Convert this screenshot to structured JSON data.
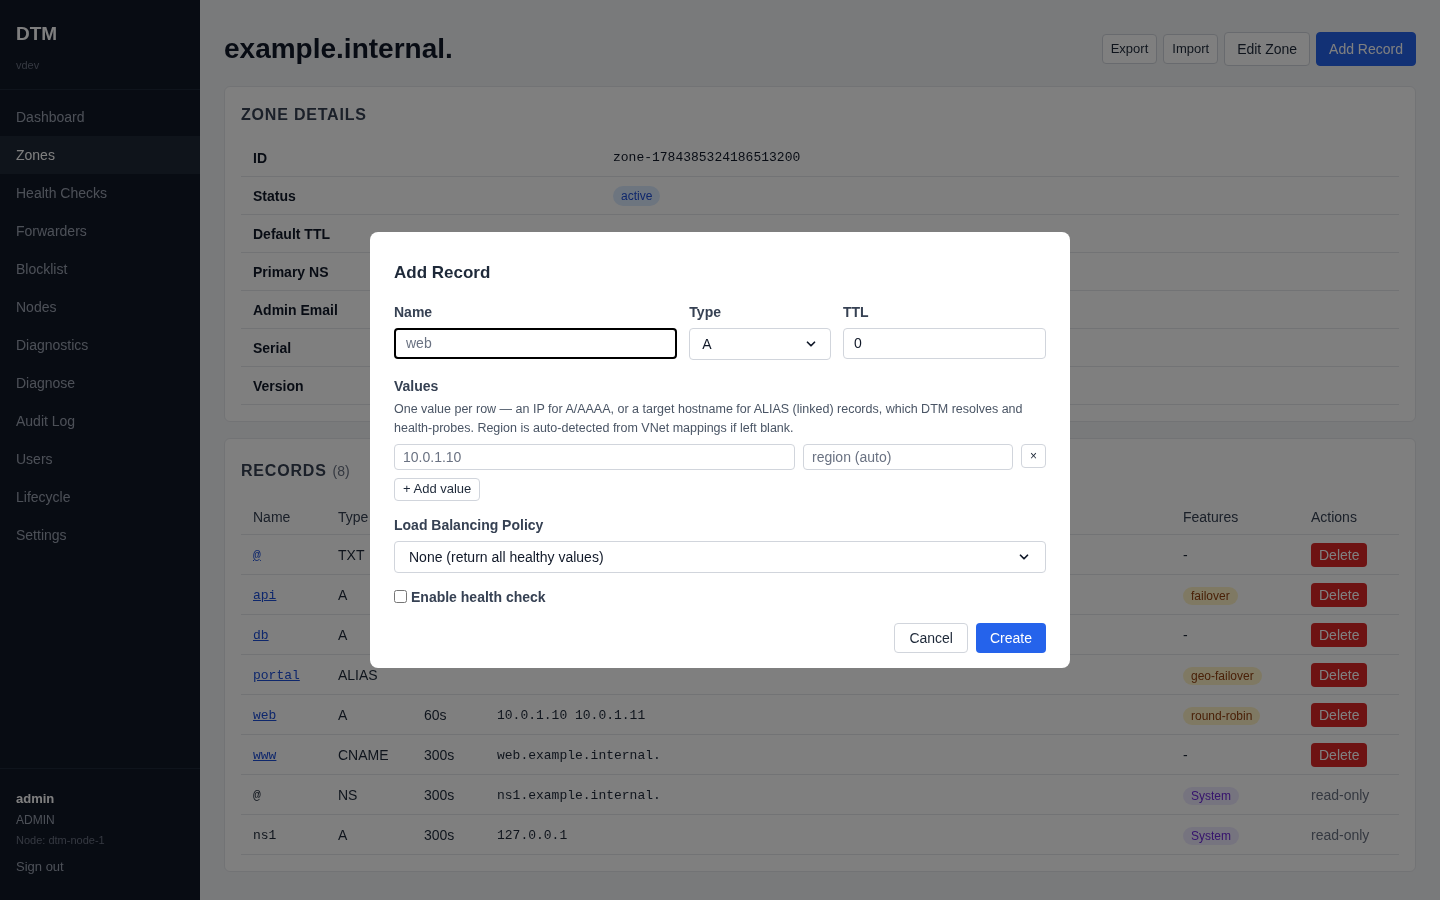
{
  "sidebar": {
    "brand": "DTM",
    "version": "vdev",
    "items": [
      {
        "label": "Dashboard",
        "selected": false
      },
      {
        "label": "Zones",
        "selected": true
      },
      {
        "label": "Health Checks",
        "selected": false
      },
      {
        "label": "Forwarders",
        "selected": false
      },
      {
        "label": "Blocklist",
        "selected": false
      },
      {
        "label": "Nodes",
        "selected": false
      },
      {
        "label": "Diagnostics",
        "selected": false
      },
      {
        "label": "Diagnose",
        "selected": false
      },
      {
        "label": "Audit Log",
        "selected": false
      },
      {
        "label": "Users",
        "selected": false
      },
      {
        "label": "Lifecycle",
        "selected": false
      },
      {
        "label": "Settings",
        "selected": false
      }
    ],
    "user": {
      "name": "admin",
      "role": "ADMIN",
      "node": "Node: dtm-node-1",
      "sign_out": "Sign out"
    }
  },
  "header": {
    "title": "example.internal.",
    "buttons": [
      {
        "label": "Export",
        "kind": "small"
      },
      {
        "label": "Import",
        "kind": "small"
      },
      {
        "label": "Edit Zone",
        "kind": "secondary"
      },
      {
        "label": "Add Record",
        "kind": "primary"
      }
    ]
  },
  "zone_details": {
    "title": "ZONE DETAILS",
    "rows": [
      {
        "label": "ID",
        "value": "zone-1784385324186513200",
        "kind": "mono"
      },
      {
        "label": "Status",
        "value": "active",
        "kind": "badge"
      },
      {
        "label": "Default TTL"
      },
      {
        "label": "Primary NS"
      },
      {
        "label": "Admin Email"
      },
      {
        "label": "Serial"
      },
      {
        "label": "Version"
      }
    ]
  },
  "records": {
    "title": "RECORDS",
    "count": "(8)",
    "columns": [
      "Name",
      "Type",
      "Features",
      "Actions"
    ],
    "rows": [
      {
        "name": "@",
        "link": true,
        "type": "TXT",
        "feature": {
          "text": "-",
          "kind": "text"
        },
        "action": {
          "label": "Delete",
          "kind": "button"
        }
      },
      {
        "name": "api",
        "link": true,
        "type": "A",
        "feature": {
          "text": "failover",
          "kind": "policy"
        },
        "action": {
          "label": "Delete",
          "kind": "button"
        }
      },
      {
        "name": "db",
        "link": true,
        "type": "A",
        "feature": {
          "text": "-",
          "kind": "text"
        },
        "action": {
          "label": "Delete",
          "kind": "button"
        }
      },
      {
        "name": "portal",
        "link": true,
        "type": "ALIAS",
        "feature": {
          "text": "geo-failover",
          "kind": "policy"
        },
        "action": {
          "label": "Delete",
          "kind": "button"
        }
      },
      {
        "name": "web",
        "link": true,
        "type": "A",
        "ttl": "60s",
        "value": "10.0.1.10 10.0.1.11",
        "feature": {
          "text": "round-robin",
          "kind": "policy"
        },
        "action": {
          "label": "Delete",
          "kind": "button"
        }
      },
      {
        "name": "www",
        "link": true,
        "type": "CNAME",
        "ttl": "300s",
        "value": "web.example.internal.",
        "feature": {
          "text": "-",
          "kind": "text"
        },
        "action": {
          "label": "Delete",
          "kind": "button"
        }
      },
      {
        "name": "@",
        "link": false,
        "type": "NS",
        "ttl": "300s",
        "value": "ns1.example.internal.",
        "feature": {
          "text": "System",
          "kind": "system"
        },
        "action": {
          "label": "read-only",
          "kind": "text"
        }
      },
      {
        "name": "ns1",
        "link": false,
        "type": "A",
        "ttl": "300s",
        "value": "127.0.0.1",
        "feature": {
          "text": "System",
          "kind": "system"
        },
        "action": {
          "label": "read-only",
          "kind": "text"
        }
      }
    ]
  },
  "modal": {
    "title": "Add Record",
    "name": {
      "label": "Name",
      "placeholder": "web",
      "focused": true
    },
    "type": {
      "label": "Type",
      "value": "A"
    },
    "ttl": {
      "label": "TTL",
      "value": "0"
    },
    "values": {
      "label": "Values",
      "help": "One value per row — an IP for A/AAAA, or a target hostname for ALIAS (linked) records, which DTM resolves and health-probes. Region is auto-detected from VNet mappings if left blank.",
      "rows": [
        {
          "value_placeholder": "10.0.1.10",
          "region_placeholder": "region (auto)",
          "remove": "×"
        }
      ],
      "add": "+ Add value"
    },
    "policy": {
      "label": "Load Balancing Policy",
      "value": "None (return all healthy values)"
    },
    "health_check": {
      "label": "Enable health check",
      "checked": false
    },
    "buttons": [
      {
        "label": "Cancel",
        "kind": "secondary"
      },
      {
        "label": "Create",
        "kind": "primary"
      }
    ]
  }
}
